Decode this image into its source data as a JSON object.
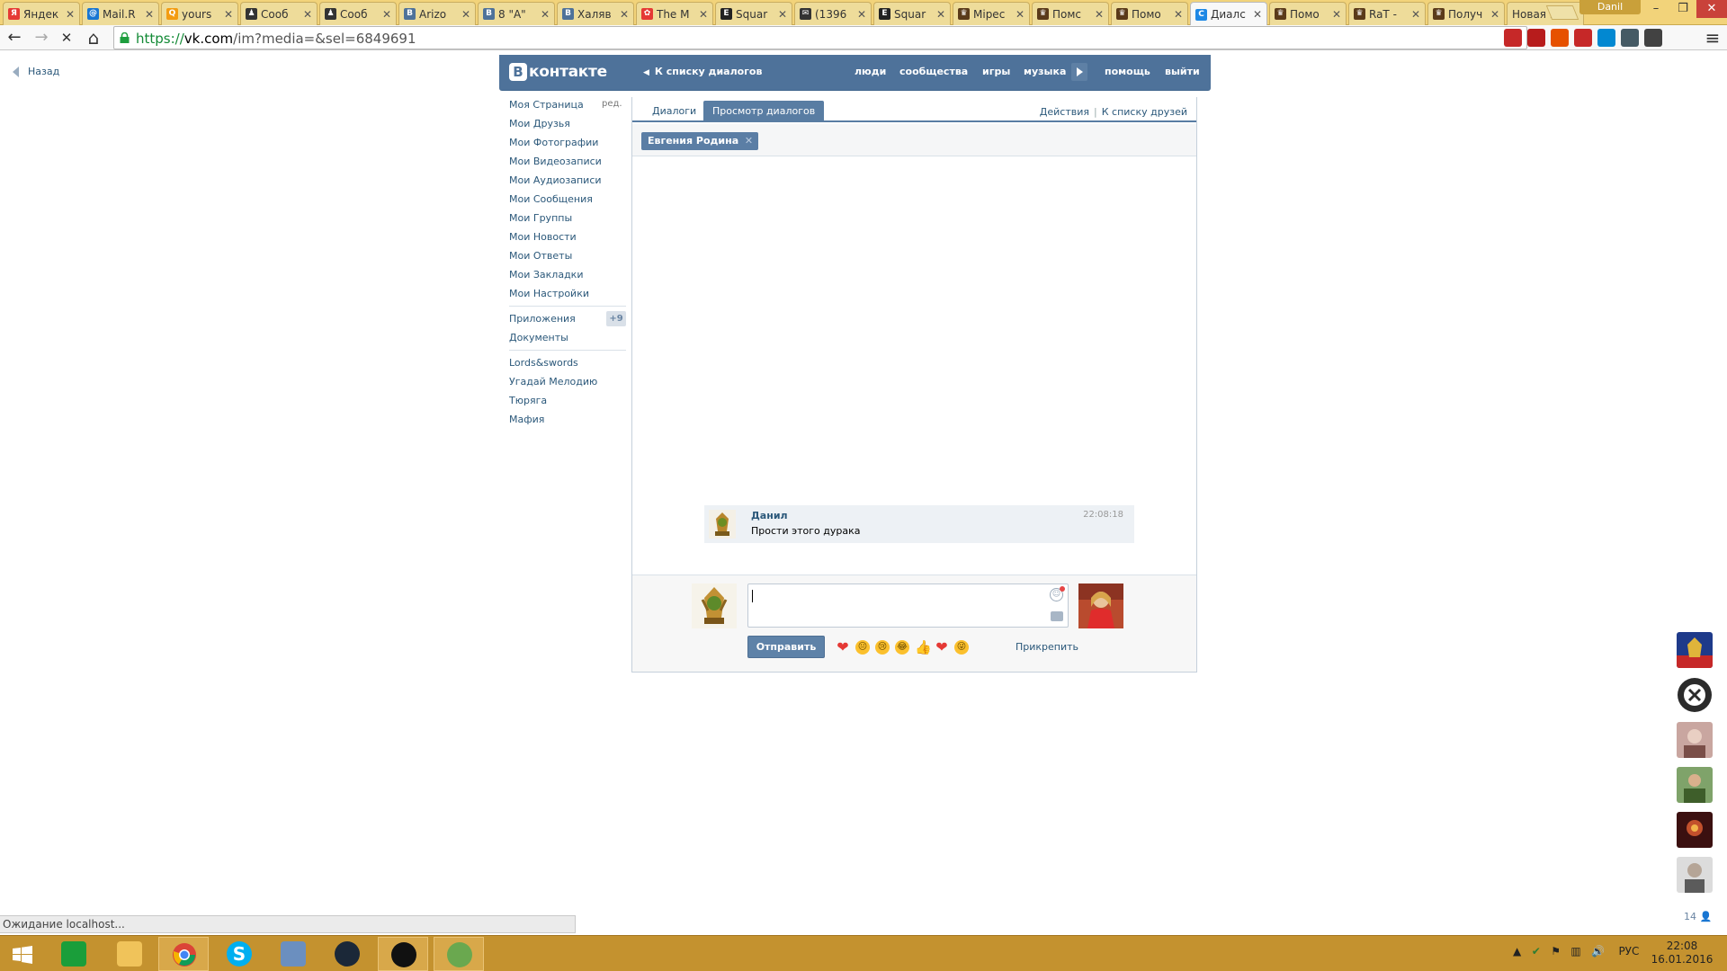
{
  "browser": {
    "tabs": [
      {
        "title": "Яндек",
        "fav": "Я",
        "color": "#e53935"
      },
      {
        "title": "Mail.R",
        "fav": "@",
        "color": "#1976d2"
      },
      {
        "title": "yours",
        "fav": "Q",
        "color": "#f39c12"
      },
      {
        "title": "Сооб",
        "fav": "♟",
        "color": "#333333"
      },
      {
        "title": "Сооб",
        "fav": "♟",
        "color": "#333333"
      },
      {
        "title": "Arizo",
        "fav": "B",
        "color": "#4e729a"
      },
      {
        "title": "8 \"A\"",
        "fav": "B",
        "color": "#4e729a"
      },
      {
        "title": "Халяв",
        "fav": "B",
        "color": "#4e729a"
      },
      {
        "title": "The M",
        "fav": "✿",
        "color": "#e53935"
      },
      {
        "title": "Squar",
        "fav": "E",
        "color": "#222222"
      },
      {
        "title": "(1396",
        "fav": "✉",
        "color": "#333333"
      },
      {
        "title": "Squar",
        "fav": "E",
        "color": "#222222"
      },
      {
        "title": "Mipec",
        "fav": "♛",
        "color": "#5a3a1a"
      },
      {
        "title": "Помс",
        "fav": "♛",
        "color": "#5a3a1a"
      },
      {
        "title": "Помо",
        "fav": "♛",
        "color": "#5a3a1a"
      },
      {
        "title": "Диалс",
        "fav": "C",
        "color": "#1e88e5",
        "active": true
      },
      {
        "title": "Помо",
        "fav": "♛",
        "color": "#5a3a1a"
      },
      {
        "title": "RaT -",
        "fav": "♛",
        "color": "#5a3a1a"
      },
      {
        "title": "Получ",
        "fav": "♛",
        "color": "#5a3a1a"
      },
      {
        "title": "Новая вк",
        "fav": "",
        "color": ""
      }
    ],
    "tab_close": "✕",
    "profile_name": "Danil",
    "window_controls": {
      "minimize": "–",
      "restore": "❐",
      "close": "✕"
    },
    "url": {
      "scheme": "https://",
      "host": "vk.com",
      "path": "/im?media=&sel=6849691"
    },
    "nav": {
      "back": "←",
      "forward": "→",
      "stop": "✕",
      "home": "⌂"
    },
    "menu_icon": "≡",
    "star": "☆",
    "extensions": [
      "#c62828",
      "#b71c1c",
      "#e65100",
      "#c62828",
      "#0288d1",
      "#455a64",
      "#424242"
    ],
    "status_text": "Ожидание localhost..."
  },
  "vk": {
    "back_label": "Назад",
    "logo_letter": "В",
    "logo_text": "контакте",
    "to_dialogs": "К списку диалогов",
    "header_links": [
      "люди",
      "сообщества",
      "игры",
      "музыка",
      "помощь",
      "выйти"
    ],
    "left_menu": {
      "edit": "ред.",
      "main": [
        "Моя Страница",
        "Мои Друзья",
        "Мои Фотографии",
        "Мои Видеозаписи",
        "Мои Аудиозаписи",
        "Мои Сообщения",
        "Мои Группы",
        "Мои Новости",
        "Мои Ответы",
        "Мои Закладки",
        "Мои Настройки"
      ],
      "secondary": [
        "Приложения",
        "Документы"
      ],
      "apps_badge": "+9",
      "apps": [
        "Lords&swords",
        "Угадай Мелодию",
        "Тюряга",
        "Мафия"
      ]
    },
    "tabs": [
      "Диалоги",
      "Просмотр диалогов"
    ],
    "actions": [
      "Действия",
      "К списку друзей"
    ],
    "peer_chip": "Евгения Родина",
    "message": {
      "author": "Данил",
      "time": "22:08:18",
      "text": "Прости этого дурака"
    },
    "composer": {
      "send": "Отправить",
      "attach": "Прикрепить",
      "emoji": [
        "heart",
        "neutral",
        "cry",
        "laugh",
        "thumb",
        "heart",
        "grin"
      ]
    },
    "right_bar": {
      "count": "14"
    }
  },
  "taskbar": {
    "lang": "РУС",
    "time": "22:08",
    "date": "16.01.2016"
  }
}
